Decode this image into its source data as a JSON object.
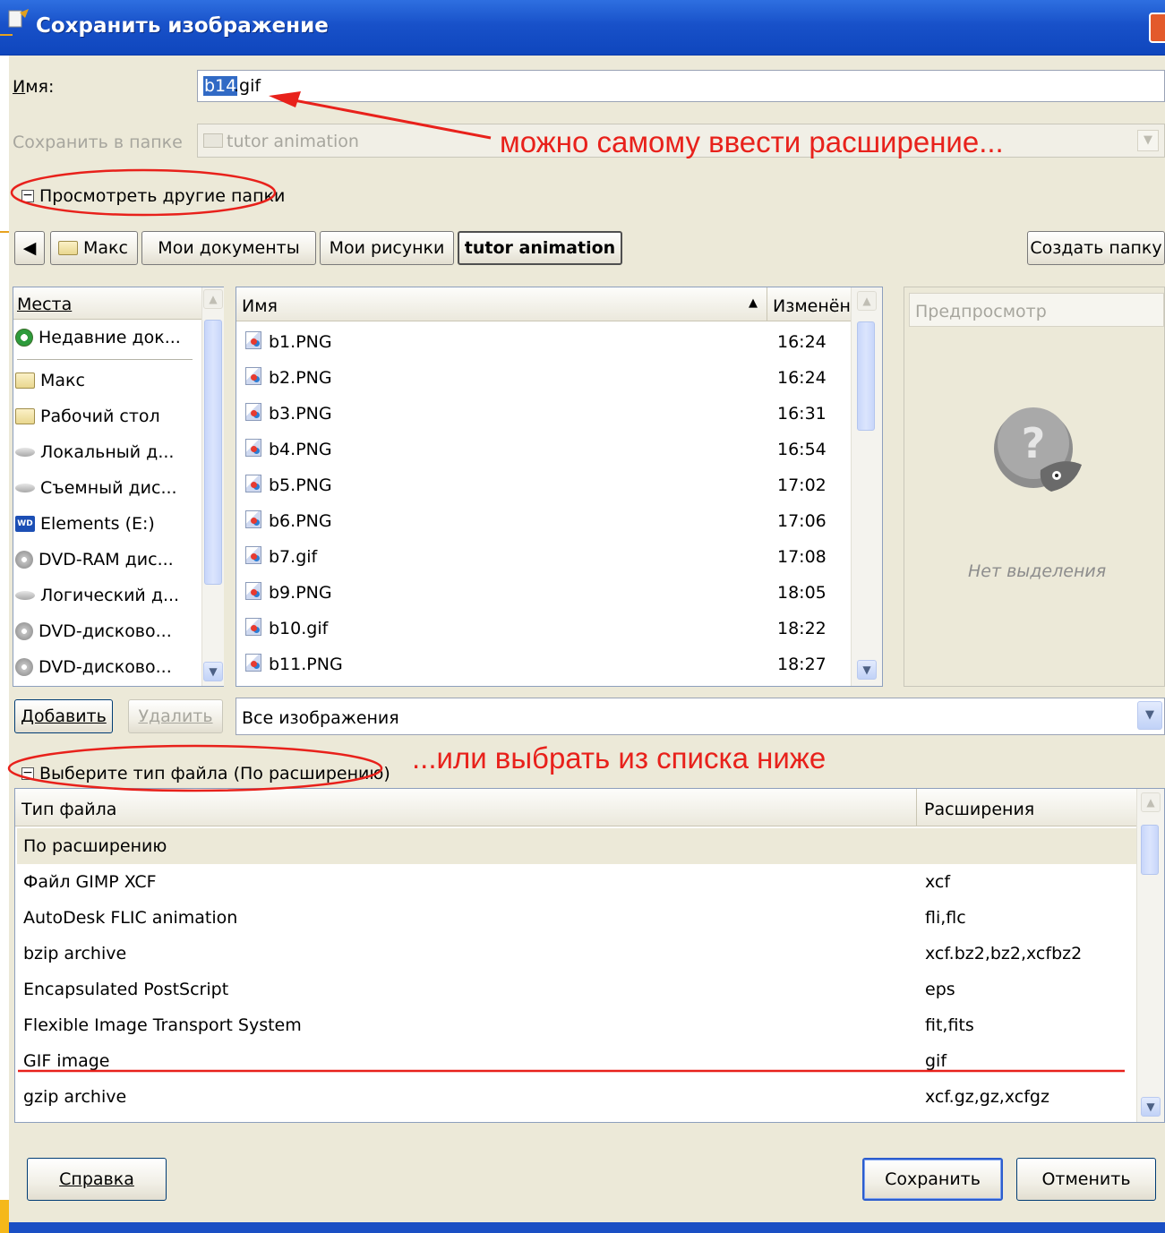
{
  "window": {
    "title": "Сохранить изображение"
  },
  "name_row": {
    "label": "Имя:",
    "value_selected": "b14",
    "value_rest": ".gif"
  },
  "folder_row": {
    "label": "Сохранить в папке",
    "value": "tutor animation"
  },
  "browse_expander": {
    "label": "Просмотреть другие папки"
  },
  "path_bar": {
    "buttons": [
      "Макс",
      "Мои документы",
      "Мои рисунки",
      "tutor animation"
    ],
    "active": "tutor animation",
    "create_folder": "Создать папку"
  },
  "places": {
    "header": "Места",
    "items": [
      {
        "label": "Недавние док...",
        "icon": "recent-icon"
      },
      {
        "label": "Макс",
        "icon": "folder-icon"
      },
      {
        "label": "Рабочий стол",
        "icon": "folder-icon"
      },
      {
        "label": "Локальный д...",
        "icon": "drive-icon"
      },
      {
        "label": "Съемный дис...",
        "icon": "drive-icon"
      },
      {
        "label": "Elements (E:)",
        "icon": "wd-drive-icon"
      },
      {
        "label": "DVD-RAM дис...",
        "icon": "cd-icon"
      },
      {
        "label": "Логический д...",
        "icon": "drive-icon"
      },
      {
        "label": "DVD-дисково...",
        "icon": "cd-icon"
      },
      {
        "label": "DVD-дисково...",
        "icon": "cd-icon"
      }
    ],
    "add_button": "Добавить",
    "remove_button": "Удалить"
  },
  "files": {
    "col_name": "Имя",
    "col_modified": "Изменён",
    "rows": [
      {
        "name": "b1.PNG",
        "time": "16:24"
      },
      {
        "name": "b2.PNG",
        "time": "16:24"
      },
      {
        "name": "b3.PNG",
        "time": "16:31"
      },
      {
        "name": "b4.PNG",
        "time": "16:54"
      },
      {
        "name": "b5.PNG",
        "time": "17:02"
      },
      {
        "name": "b6.PNG",
        "time": "17:06"
      },
      {
        "name": "b7.gif",
        "time": "17:08"
      },
      {
        "name": "b9.PNG",
        "time": "18:05"
      },
      {
        "name": "b10.gif",
        "time": "18:22"
      },
      {
        "name": "b11.PNG",
        "time": "18:27"
      }
    ],
    "filter": "Все изображения"
  },
  "preview": {
    "header": "Предпросмотр",
    "empty_text": "Нет выделения"
  },
  "filetype_expander": {
    "label": "Выберите тип файла (По расширению)"
  },
  "filetypes": {
    "col_type": "Тип файла",
    "col_ext": "Расширения",
    "rows": [
      {
        "type": "По расширению",
        "ext": ""
      },
      {
        "type": "Файл GIMP XCF",
        "ext": "xcf"
      },
      {
        "type": "AutoDesk FLIC animation",
        "ext": "fli,flc"
      },
      {
        "type": "bzip archive",
        "ext": "xcf.bz2,bz2,xcfbz2"
      },
      {
        "type": "Encapsulated PostScript",
        "ext": "eps"
      },
      {
        "type": "Flexible Image Transport System",
        "ext": "fit,fits"
      },
      {
        "type": "GIF image",
        "ext": "gif"
      },
      {
        "type": "gzip archive",
        "ext": "xcf.gz,gz,xcfgz"
      }
    ]
  },
  "buttons": {
    "help": "Справка",
    "save": "Сохранить",
    "cancel": "Отменить"
  },
  "annotations": {
    "top": "можно самому ввести расширение...",
    "bottom": "...или выбрать из списка ниже",
    "color": "#e8211b"
  }
}
